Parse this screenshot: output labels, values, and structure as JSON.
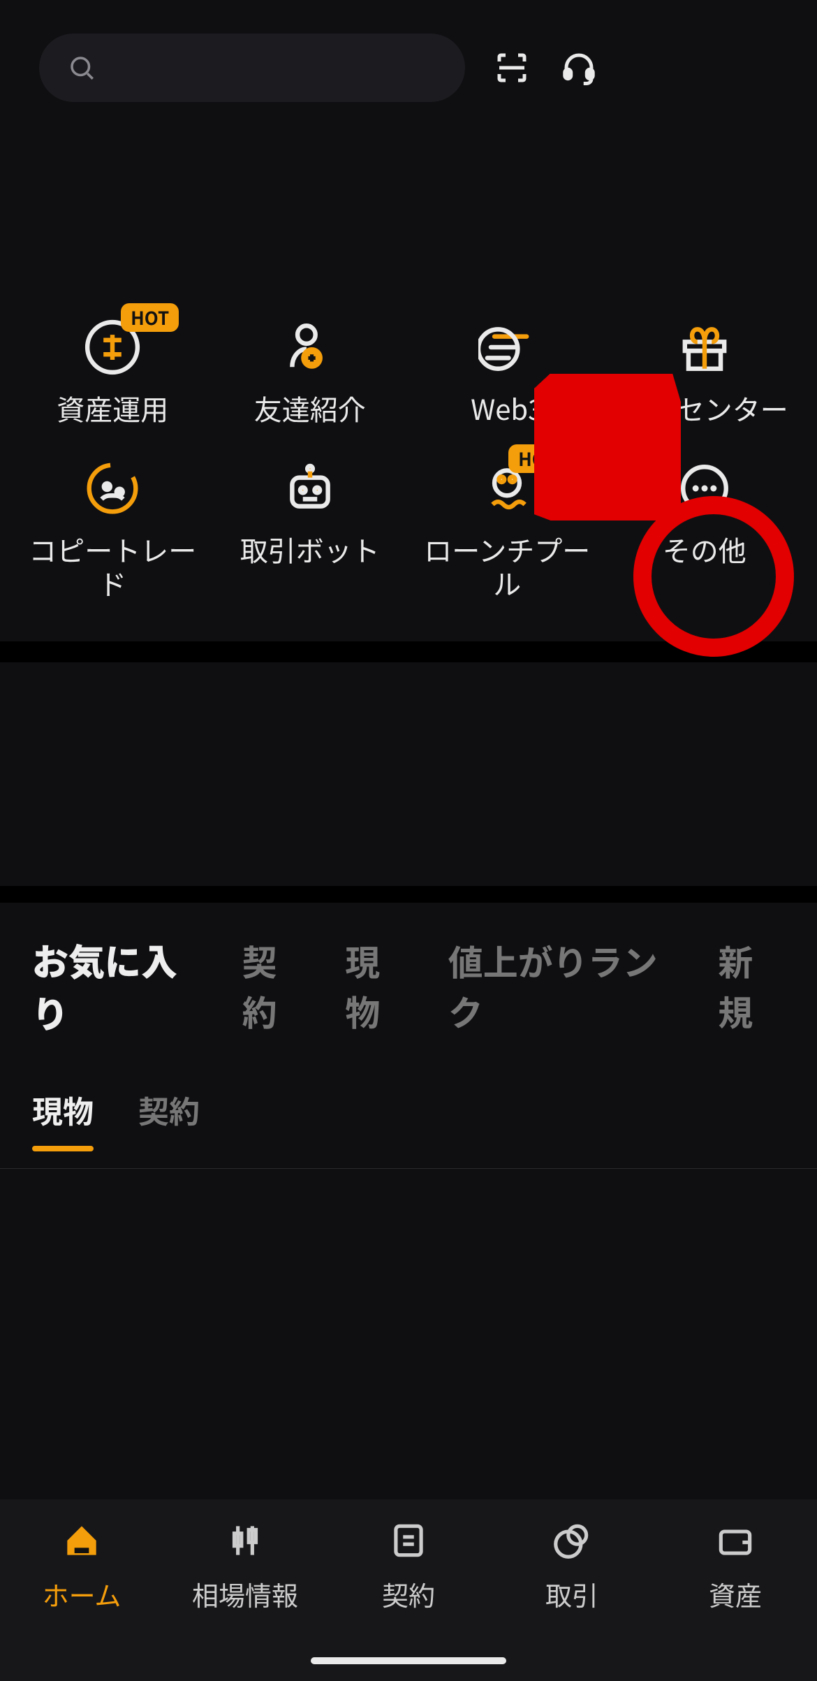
{
  "badges": {
    "hot": "HOT"
  },
  "grid": {
    "items": [
      {
        "label": "資産運用"
      },
      {
        "label": "友達紹介"
      },
      {
        "label": "Web3"
      },
      {
        "label": "特典センター"
      },
      {
        "label": "コピートレー\nド"
      },
      {
        "label": "取引ボット"
      },
      {
        "label": "ローンチプー\nル"
      },
      {
        "label": "その他"
      }
    ]
  },
  "tabs1": {
    "items": [
      {
        "label": "お気に入り"
      },
      {
        "label": "契約"
      },
      {
        "label": "現物"
      },
      {
        "label": "値上がりランク"
      },
      {
        "label": "新規"
      }
    ]
  },
  "tabs2": {
    "items": [
      {
        "label": "現物"
      },
      {
        "label": "契約"
      }
    ]
  },
  "nav": {
    "items": [
      {
        "label": "ホーム"
      },
      {
        "label": "相場情報"
      },
      {
        "label": "契約"
      },
      {
        "label": "取引"
      },
      {
        "label": "資産"
      }
    ]
  }
}
